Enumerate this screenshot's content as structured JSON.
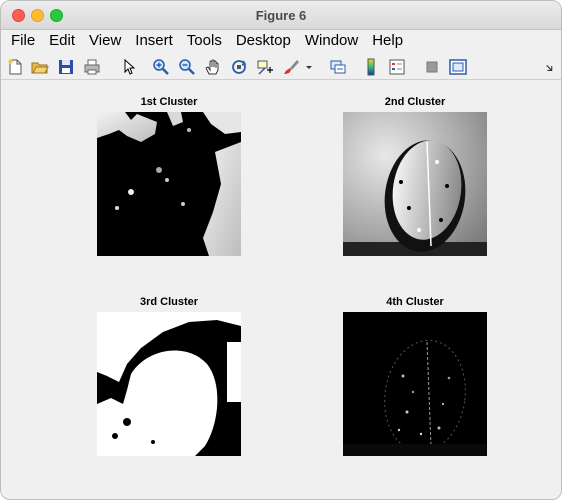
{
  "window": {
    "title": "Figure 6"
  },
  "menu": [
    "File",
    "Edit",
    "View",
    "Insert",
    "Tools",
    "Desktop",
    "Window",
    "Help"
  ],
  "toolbar": {
    "icons": [
      "new-figure-icon",
      "open-file-icon",
      "save-icon",
      "print-icon",
      "pointer-icon",
      "zoom-in-icon",
      "zoom-out-icon",
      "pan-hand-icon",
      "rotate-3d-icon",
      "data-cursor-icon",
      "brush-icon",
      "brush-dropdown-icon",
      "link-plot-icon",
      "colorbar-icon",
      "legend-icon",
      "hide-plot-tools-icon",
      "show-plot-tools-icon",
      "dock-icon"
    ]
  },
  "subplots": [
    {
      "title": "1st Cluster"
    },
    {
      "title": "2nd Cluster"
    },
    {
      "title": "3rd Cluster"
    },
    {
      "title": "4th Cluster"
    }
  ]
}
